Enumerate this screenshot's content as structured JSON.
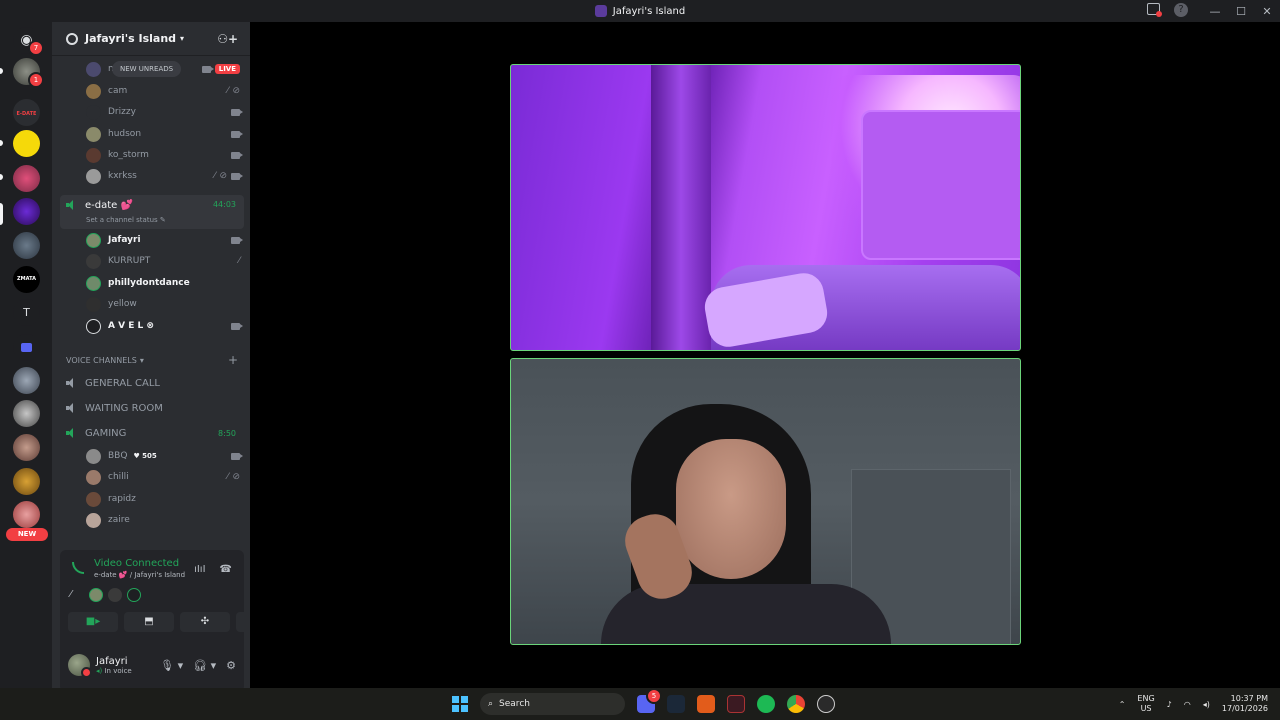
{
  "window": {
    "title": "Jafayri's Island",
    "help": "?"
  },
  "servers": {
    "dm_badge": "7",
    "server1_badge": "1",
    "edate_label": "E-DATE",
    "zmata_label": "ZMATA",
    "t_label": "T",
    "new_label": "NEW"
  },
  "guild": {
    "name": "Jafayri's Island"
  },
  "new_unreads": "NEW UNREADS",
  "top_users": [
    {
      "name": "m",
      "live": "LIVE"
    },
    {
      "name": "cam"
    },
    {
      "name": "Drizzy"
    },
    {
      "name": "hudson"
    },
    {
      "name": "ko_storm"
    },
    {
      "name": "kxrkss"
    }
  ],
  "edate_channel": {
    "name": "e-date 💕",
    "timer": "44:03",
    "status": "Set a channel status"
  },
  "edate_users": [
    {
      "name": "Jafayri"
    },
    {
      "name": "KURRUPT"
    },
    {
      "name": "phillydontdance"
    },
    {
      "name": "yellow"
    },
    {
      "name": "A V E L ⊗"
    }
  ],
  "voice_category": "VOICE CHANNELS",
  "voice_channels": [
    {
      "name": "GENERAL CALL"
    },
    {
      "name": "WAITING ROOM"
    },
    {
      "name": "GAMING",
      "timer": "8:50"
    }
  ],
  "gaming_users": [
    {
      "name": "BBQ",
      "tag": "505"
    },
    {
      "name": "chilli"
    },
    {
      "name": "rapidz"
    },
    {
      "name": "zaire"
    }
  ],
  "voice_panel": {
    "status": "Video Connected",
    "location": "e-date 💕 / Jafayri's Island"
  },
  "user": {
    "name": "Jafayri",
    "status": "In voice"
  },
  "taskbar": {
    "search_placeholder": "Search",
    "discord_badge": "5",
    "lang": "ENG",
    "region": "US",
    "time": "10:37 PM",
    "date": "17/01/2026"
  }
}
